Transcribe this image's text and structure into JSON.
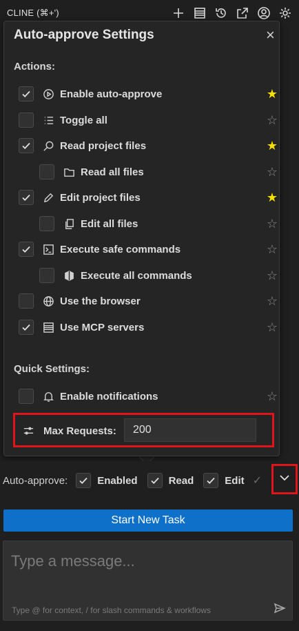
{
  "header": {
    "title": "CLINE (⌘+')",
    "icons": [
      "plus-icon",
      "server-icon",
      "history-icon",
      "popout-icon",
      "account-icon",
      "gear-icon"
    ]
  },
  "popup": {
    "title": "Auto-approve Settings",
    "close": "×",
    "actions_label": "Actions:",
    "actions": [
      {
        "label": "Enable auto-approve",
        "checked": true,
        "favorite": true,
        "icon": "play-circle-icon"
      },
      {
        "label": "Toggle all",
        "checked": false,
        "favorite": false,
        "icon": "list-icon"
      },
      {
        "label": "Read project files",
        "checked": true,
        "favorite": true,
        "icon": "search-icon"
      },
      {
        "label": "Read all files",
        "checked": false,
        "favorite": false,
        "icon": "folder-icon"
      },
      {
        "label": "Edit project files",
        "checked": true,
        "favorite": true,
        "icon": "pencil-icon"
      },
      {
        "label": "Edit all files",
        "checked": false,
        "favorite": false,
        "icon": "copy-icon"
      },
      {
        "label": "Execute safe commands",
        "checked": true,
        "favorite": false,
        "icon": "terminal-icon"
      },
      {
        "label": "Execute all commands",
        "checked": false,
        "favorite": false,
        "icon": "cube-icon"
      },
      {
        "label": "Use the browser",
        "checked": false,
        "favorite": false,
        "icon": "globe-icon"
      },
      {
        "label": "Use MCP servers",
        "checked": true,
        "favorite": false,
        "icon": "server-icon"
      }
    ],
    "quick_label": "Quick Settings:",
    "notifications": {
      "label": "Enable notifications",
      "checked": false,
      "favorite": false,
      "icon": "bell-icon"
    },
    "max_requests": {
      "label": "Max Requests:",
      "value": "200",
      "icon": "sliders-icon"
    }
  },
  "auto_approve": {
    "label": "Auto-approve:",
    "items": [
      {
        "label": "Enabled",
        "checked": true
      },
      {
        "label": "Read",
        "checked": true
      },
      {
        "label": "Edit",
        "checked": true
      }
    ],
    "overflow": "✓"
  },
  "new_task_label": "Start New Task",
  "message": {
    "placeholder": "Type a message...",
    "hint": "Type @ for context, / for slash commands & workflows"
  },
  "colors": {
    "accent": "#0e70c8",
    "star": "#f5e000",
    "highlight": "#e0151c"
  }
}
